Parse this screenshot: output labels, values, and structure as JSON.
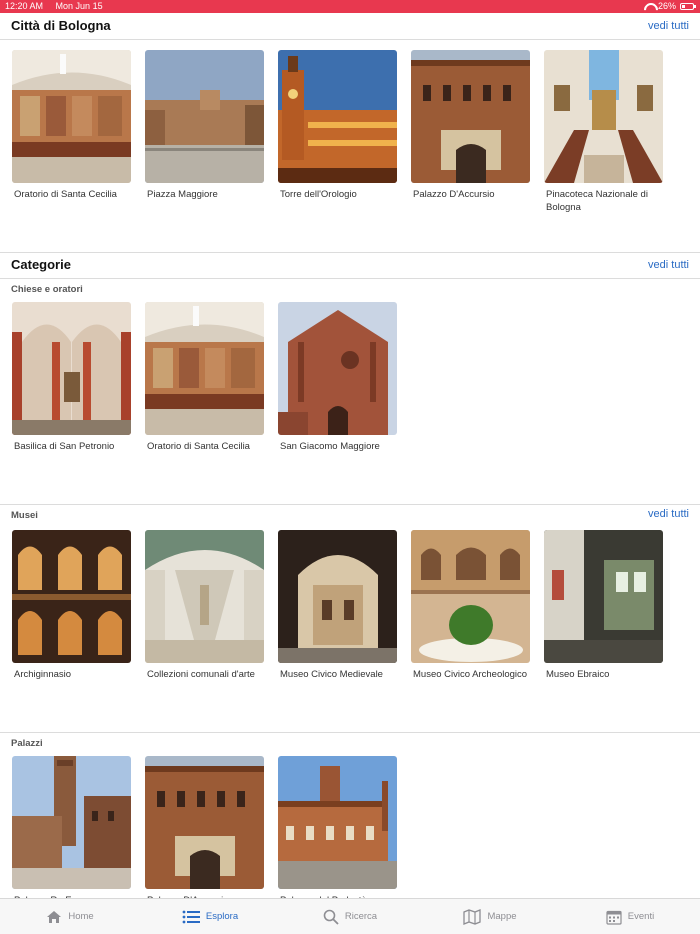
{
  "status": {
    "time": "12:20 AM",
    "date": "Mon Jun 15",
    "battery": "26%",
    "battery_level": 0.26
  },
  "city": {
    "title": "Città di Bologna",
    "see_all": "vedi tutti",
    "items": [
      {
        "label": "Oratorio di Santa Cecilia",
        "image": "fresco-hall"
      },
      {
        "label": "Piazza Maggiore",
        "image": "square"
      },
      {
        "label": "Torre dell'Orologio",
        "image": "tower-dusk"
      },
      {
        "label": "Palazzo D'Accursio",
        "image": "palace-facade"
      },
      {
        "label": "Pinacoteca Nazionale di Bologna",
        "image": "gallery-staircase"
      }
    ]
  },
  "categories": {
    "title": "Categorie",
    "see_all": "vedi tutti",
    "groups": [
      {
        "title": "Chiese e oratori",
        "see_all": "",
        "items": [
          {
            "label": "Basilica di San Petronio",
            "image": "gothic-nave"
          },
          {
            "label": "Oratorio di Santa Cecilia",
            "image": "fresco-hall"
          },
          {
            "label": "San Giacomo Maggiore",
            "image": "brick-church"
          }
        ]
      },
      {
        "title": "Musei",
        "see_all": "vedi tutti",
        "items": [
          {
            "label": "Archiginnasio",
            "image": "arcade-courtyard"
          },
          {
            "label": "Collezioni comunali d'arte",
            "image": "vaulted-gallery"
          },
          {
            "label": "Museo Civico Medievale",
            "image": "portico-court"
          },
          {
            "label": "Museo Civico Archeologico",
            "image": "courtyard-garden"
          },
          {
            "label": "Museo Ebraico",
            "image": "museum-room"
          }
        ]
      },
      {
        "title": "Palazzi",
        "see_all": "",
        "items": [
          {
            "label": "Palazzo Re Enzo",
            "image": "tower-palace"
          },
          {
            "label": "Palazzo D'Accursio",
            "image": "palace-facade"
          },
          {
            "label": "Palazzo del Podestà",
            "image": "podesta"
          }
        ]
      }
    ]
  },
  "tabs": [
    {
      "label": "Home",
      "icon": "home-icon",
      "active": false
    },
    {
      "label": "Esplora",
      "icon": "list-icon",
      "active": true
    },
    {
      "label": "Ricerca",
      "icon": "search-icon",
      "active": false
    },
    {
      "label": "Mappe",
      "icon": "map-icon",
      "active": false
    },
    {
      "label": "Eventi",
      "icon": "calendar-icon",
      "active": false
    }
  ],
  "colors": {
    "status_bar": "#e8384f",
    "accent": "#2a6bc4",
    "tab_inactive": "#8e8e93"
  }
}
